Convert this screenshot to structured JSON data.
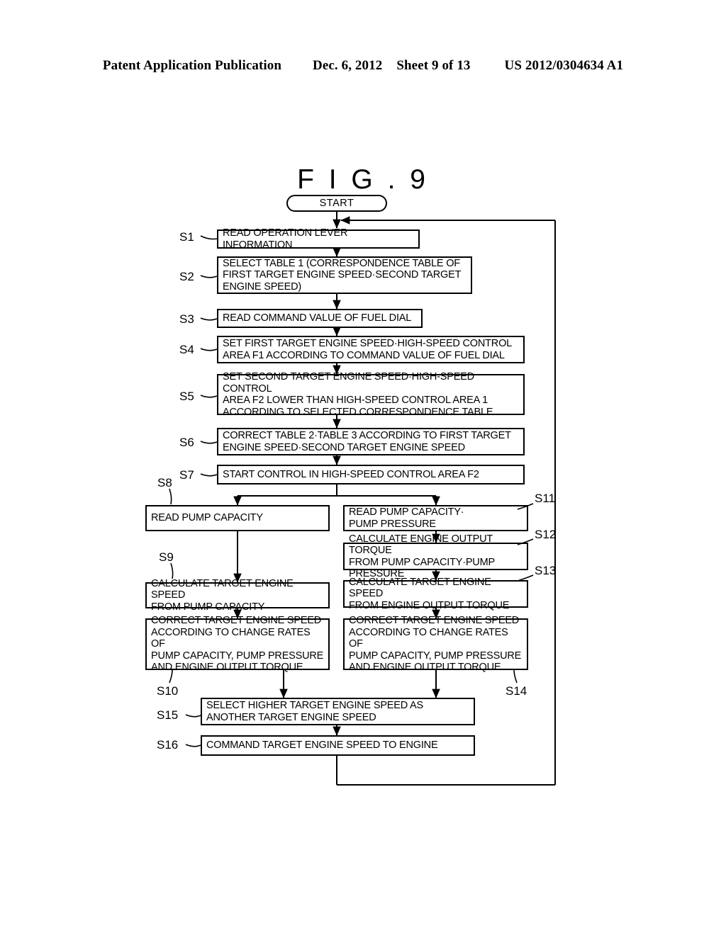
{
  "header": {
    "publication": "Patent Application Publication",
    "date": "Dec. 6, 2012",
    "sheet": "Sheet 9 of 13",
    "number": "US 2012/0304634 A1"
  },
  "figure": {
    "title": "F I G . 9",
    "start_label": "START"
  },
  "steps": [
    {
      "id": "S1",
      "label": "S1",
      "text": "READ OPERATION LEVER INFORMATION"
    },
    {
      "id": "S2",
      "label": "S2",
      "text": "SELECT TABLE 1 (CORRESPONDENCE TABLE OF\nFIRST TARGET ENGINE SPEED·SECOND TARGET\nENGINE SPEED)"
    },
    {
      "id": "S3",
      "label": "S3",
      "text": "READ COMMAND VALUE OF FUEL DIAL"
    },
    {
      "id": "S4",
      "label": "S4",
      "text": "SET FIRST TARGET ENGINE SPEED·HIGH-SPEED CONTROL\nAREA F1 ACCORDING TO COMMAND VALUE OF FUEL DIAL"
    },
    {
      "id": "S5",
      "label": "S5",
      "text": "SET SECOND TARGET ENGINE SPEED·HIGH-SPEED CONTROL\nAREA F2 LOWER THAN HIGH-SPEED CONTROL AREA 1\nACCORDING TO SELECTED CORRESPONDENCE TABLE"
    },
    {
      "id": "S6",
      "label": "S6",
      "text": "CORRECT TABLE 2·TABLE 3 ACCORDING TO FIRST TARGET\nENGINE SPEED·SECOND TARGET ENGINE SPEED"
    },
    {
      "id": "S7",
      "label": "S7",
      "text": "START CONTROL IN HIGH-SPEED CONTROL AREA F2"
    },
    {
      "id": "S8",
      "label": "S8",
      "text": "READ PUMP CAPACITY"
    },
    {
      "id": "S9",
      "label": "S9",
      "text": "CALCULATE TARGET ENGINE SPEED\nFROM PUMP CAPACITY"
    },
    {
      "id": "S10",
      "label": "S10",
      "text": "CORRECT TARGET ENGINE SPEED\nACCORDING TO CHANGE RATES OF\nPUMP CAPACITY, PUMP PRESSURE\nAND ENGINE OUTPUT TORQUE"
    },
    {
      "id": "S11",
      "label": "S11",
      "text": "READ PUMP CAPACITY·\nPUMP PRESSURE"
    },
    {
      "id": "S12",
      "label": "S12",
      "text": "CALCULATE ENGINE OUTPUT TORQUE\nFROM PUMP CAPACITY·PUMP PRESSURE"
    },
    {
      "id": "S13",
      "label": "S13",
      "text": "CALCULATE TARGET ENGINE SPEED\nFROM ENGINE OUTPUT TORQUE"
    },
    {
      "id": "S14",
      "label": "S14",
      "text": "CORRECT TARGET ENGINE SPEED\nACCORDING TO CHANGE RATES OF\nPUMP CAPACITY, PUMP PRESSURE\nAND ENGINE OUTPUT TORQUE"
    },
    {
      "id": "S15",
      "label": "S15",
      "text": "SELECT HIGHER TARGET ENGINE SPEED AS\nANOTHER TARGET ENGINE SPEED"
    },
    {
      "id": "S16",
      "label": "S16",
      "text": "COMMAND TARGET ENGINE SPEED TO ENGINE"
    }
  ],
  "colors": {
    "ink": "#000000",
    "paper": "#ffffff"
  }
}
